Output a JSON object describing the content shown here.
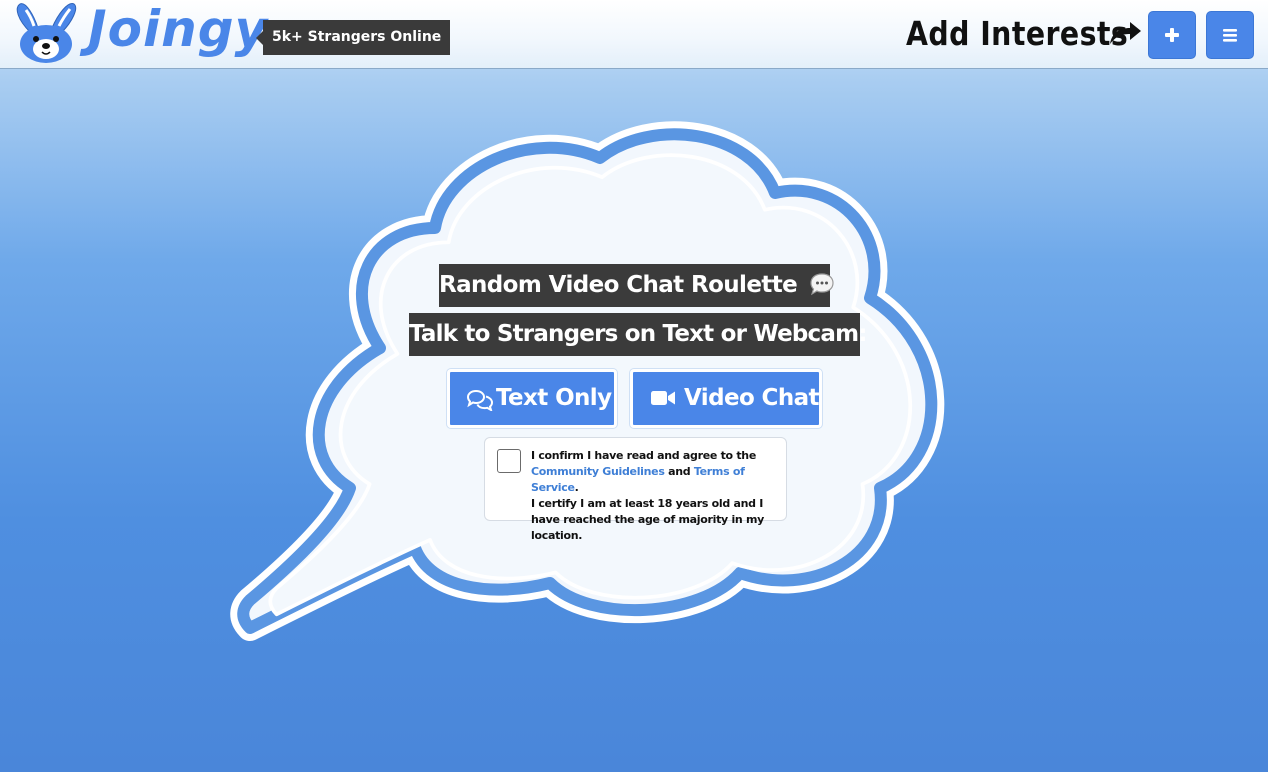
{
  "header": {
    "logo_text": "Joingy",
    "online_badge": "5k+ Strangers Online",
    "add_interests_label": "Add Interests",
    "plus_button_icon": "plus-icon",
    "menu_button_icon": "hamburger-menu-icon"
  },
  "main": {
    "title": "Random Video Chat Roulette",
    "subtitle": "Talk to Strangers on Text or Webcam:",
    "text_only_button": "Text Only",
    "video_chat_button": "Video Chat"
  },
  "consent": {
    "line1": "I confirm I have read and agree to the",
    "community_link": "Community Guidelines",
    "and_word": "and",
    "terms_link": "Terms of Service",
    "period": ".",
    "line3": "I certify I am at least 18 years old and I have reached the age of majority in my location."
  },
  "colors": {
    "accent": "#4a86e8",
    "heading_bg": "#3b3b3b"
  }
}
